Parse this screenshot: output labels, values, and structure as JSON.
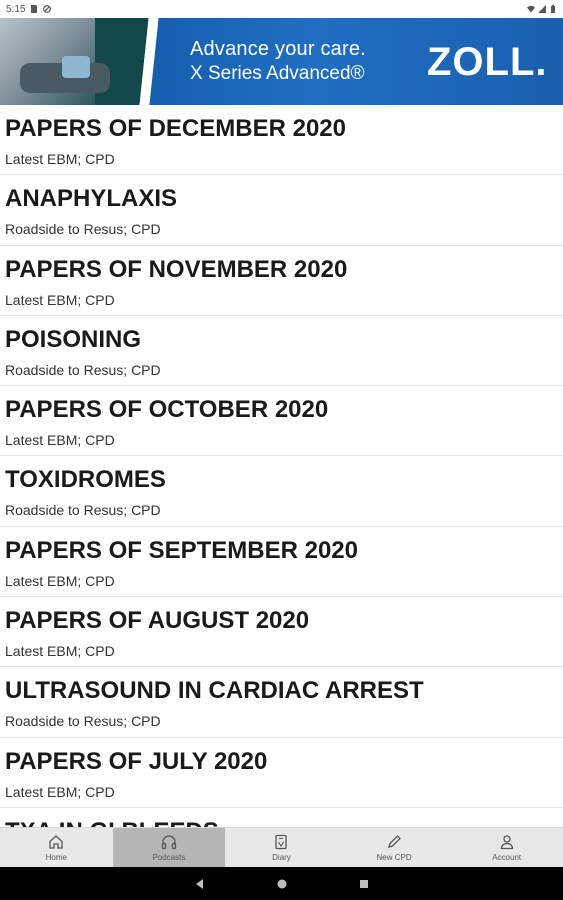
{
  "status_bar": {
    "time": "5:15"
  },
  "banner": {
    "line1": "Advance your care.",
    "line2": "X Series Advanced®",
    "logo": "ZOLL."
  },
  "episodes": [
    {
      "title": "PAPERS OF DECEMBER 2020",
      "subtitle": "Latest EBM; CPD"
    },
    {
      "title": "ANAPHYLAXIS",
      "subtitle": "Roadside to Resus; CPD"
    },
    {
      "title": "PAPERS OF NOVEMBER 2020",
      "subtitle": "Latest EBM; CPD"
    },
    {
      "title": "POISONING",
      "subtitle": "Roadside to Resus; CPD"
    },
    {
      "title": "PAPERS OF OCTOBER 2020",
      "subtitle": "Latest EBM; CPD"
    },
    {
      "title": "TOXIDROMES",
      "subtitle": "Roadside to Resus; CPD"
    },
    {
      "title": "PAPERS OF SEPTEMBER 2020",
      "subtitle": "Latest EBM; CPD"
    },
    {
      "title": "PAPERS OF AUGUST 2020",
      "subtitle": "Latest EBM; CPD"
    },
    {
      "title": "ULTRASOUND IN CARDIAC ARREST",
      "subtitle": "Roadside to Resus; CPD"
    },
    {
      "title": "PAPERS OF JULY 2020",
      "subtitle": "Latest EBM; CPD"
    },
    {
      "title": "TXA IN GI BLEEDS",
      "subtitle": ""
    }
  ],
  "tabs": [
    {
      "label": "Home",
      "icon": "home-icon",
      "active": false
    },
    {
      "label": "Podcasts",
      "icon": "headphones-icon",
      "active": true
    },
    {
      "label": "Diary",
      "icon": "diary-icon",
      "active": false
    },
    {
      "label": "New CPD",
      "icon": "pencil-icon",
      "active": false
    },
    {
      "label": "Account",
      "icon": "person-icon",
      "active": false
    }
  ]
}
